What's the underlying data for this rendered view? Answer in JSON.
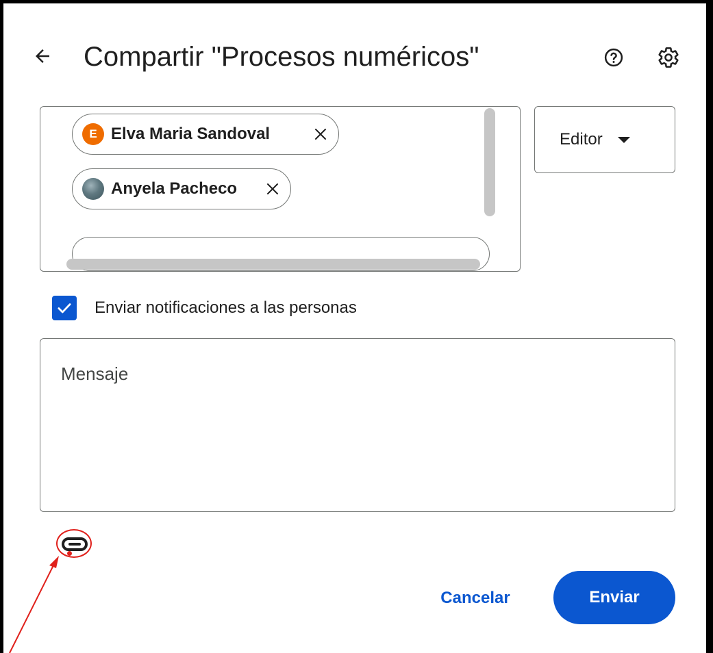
{
  "dialog": {
    "title": "Compartir \"Procesos numéricos\""
  },
  "icons": {
    "back": "arrow-back-icon",
    "help": "help-circle-icon",
    "settings": "gear-icon",
    "remove": "close-icon",
    "dropdown": "caret-down-icon",
    "checkbox": "checkmark-icon",
    "link": "link-icon"
  },
  "recipients": [
    {
      "name": "Elva Maria Sandoval",
      "avatar_letter": "E",
      "avatar_color": "#ef6c00"
    },
    {
      "name": "Anyela Pacheco",
      "avatar_letter": "",
      "avatar_color": "#5f7880"
    }
  ],
  "role": {
    "selected": "Editor"
  },
  "notify": {
    "label": "Enviar notificaciones a las personas",
    "checked": true
  },
  "message": {
    "placeholder": "Mensaje",
    "value": ""
  },
  "actions": {
    "cancel_label": "Cancelar",
    "send_label": "Enviar"
  },
  "colors": {
    "primary": "#0b57d0",
    "annotation": "#e0201b",
    "frame": "#000000"
  }
}
